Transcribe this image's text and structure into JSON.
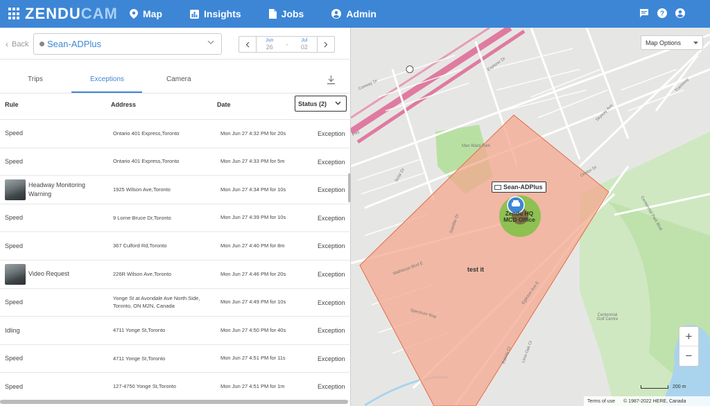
{
  "brand": {
    "part1": "ZENDU",
    "part2": "CAM"
  },
  "nav": {
    "items": [
      "Map",
      "Insights",
      "Jobs",
      "Admin"
    ]
  },
  "filter": {
    "back_label": "Back",
    "vehicle": "Sean-ADPlus",
    "date_from_month": "Jun",
    "date_from_day": "26",
    "date_to_month": "Jul",
    "date_to_day": "02",
    "date_sep": "-"
  },
  "tabs": [
    "Trips",
    "Exceptions",
    "Camera"
  ],
  "active_tab": "Exceptions",
  "table": {
    "headers": {
      "rule": "Rule",
      "address": "Address",
      "date": "Date"
    },
    "status_filter": "Status (2)",
    "rows": [
      {
        "rule": "Speed",
        "address": "Ontario 401 Express,Toronto",
        "date": "Mon Jun 27 4:32 PM for 20s",
        "type": "Exception",
        "thumb": false
      },
      {
        "rule": "Speed",
        "address": "Ontario 401 Express,Toronto",
        "date": "Mon Jun 27 4:33 PM for 5m",
        "type": "Exception",
        "thumb": false
      },
      {
        "rule": "Headway Monitoring Warning",
        "address": "1925 Wilson Ave,Toronto",
        "date": "Mon Jun 27 4:34 PM for 10s",
        "type": "Exception",
        "thumb": true
      },
      {
        "rule": "Speed",
        "address": "9 Lorne Bruce Dr,Toronto",
        "date": "Mon Jun 27 4:39 PM for 10s",
        "type": "Exception",
        "thumb": false
      },
      {
        "rule": "Speed",
        "address": "367 Culford Rd,Toronto",
        "date": "Mon Jun 27 4:40 PM for 8m",
        "type": "Exception",
        "thumb": false
      },
      {
        "rule": "Video Request",
        "address": "226R Wilson Ave,Toronto",
        "date": "Mon Jun 27 4:46 PM for 20s",
        "type": "Exception",
        "thumb": true
      },
      {
        "rule": "Speed",
        "address": "Yonge St at Avondale Ave North Side, Toronto, ON M2N, Canada",
        "date": "Mon Jun 27 4:49 PM for 10s",
        "type": "Exception",
        "thumb": false
      },
      {
        "rule": "Idling",
        "address": "4711 Yonge St,Toronto",
        "date": "Mon Jun 27 4:50 PM for 40s",
        "type": "Exception",
        "thumb": false
      },
      {
        "rule": "Speed",
        "address": "4711 Yonge St,Toronto",
        "date": "Mon Jun 27 4:51 PM for 11s",
        "type": "Exception",
        "thumb": false
      },
      {
        "rule": "Speed",
        "address": "127-4750 Yonge St,Toronto",
        "date": "Mon Jun 27 4:51 PM for 1m",
        "type": "Exception",
        "thumb": false
      }
    ]
  },
  "map": {
    "options_label": "Map Options",
    "vehicle_label": "Sean-ADPlus",
    "geofence_label": "Zendu HQ MCD Office",
    "zone_label": "test it",
    "zoom_in": "+",
    "zoom_out": "−",
    "scale_label": "200 m",
    "terms": "Terms of use",
    "copyright": "© 1987-2022 HERE, Canada",
    "streets": [
      "Conway Dr",
      "Explorer Dr",
      "Skyway Ave",
      "Matheson Blvd E",
      "Eglinton Ave E",
      "Satellite Dr",
      "Spectrum Way",
      "Centennial Park Blvd",
      "Solar Dr",
      "Fwy",
      "Orbitor Dr",
      "Transway",
      "Lime Oak Ct",
      "Rakely Ct",
      "Max Ward Park",
      "Centennial Golf Centre"
    ]
  },
  "colors": {
    "accent": "#3d86d6",
    "zone_fill": "#f4a88f",
    "zone_stroke": "#e56a4a",
    "geofence": "#7dc242",
    "highway": "#e07aa0",
    "park": "#b9e0a3"
  }
}
